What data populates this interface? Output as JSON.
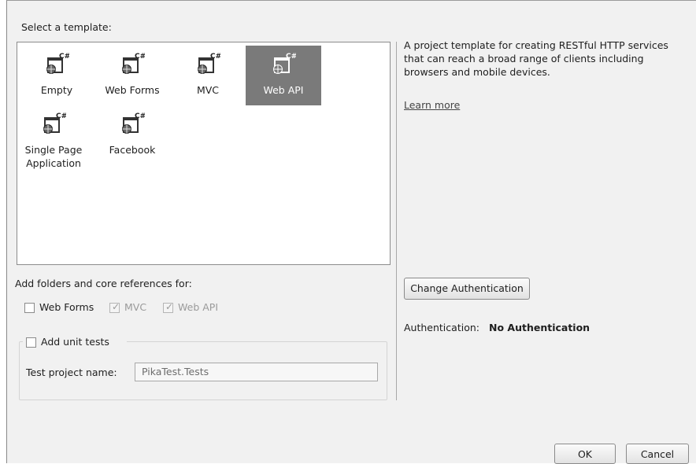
{
  "header": {
    "select_template_label": "Select a template:"
  },
  "templates": [
    {
      "name": "Empty",
      "selected": false,
      "icon": "csharp-web-project-icon"
    },
    {
      "name": "Web Forms",
      "selected": false,
      "icon": "csharp-web-project-icon"
    },
    {
      "name": "MVC",
      "selected": false,
      "icon": "csharp-web-project-icon"
    },
    {
      "name": "Web API",
      "selected": true,
      "icon": "csharp-web-project-icon"
    },
    {
      "name": "Single Page\nApplication",
      "selected": false,
      "icon": "csharp-web-project-icon"
    },
    {
      "name": "Facebook",
      "selected": false,
      "icon": "csharp-web-project-icon"
    }
  ],
  "description": {
    "text": "A project template for creating RESTful HTTP services that can reach a broad range of clients including browsers and mobile devices.",
    "learn_more": "Learn more"
  },
  "folders": {
    "label": "Add folders and core references for:",
    "options": [
      {
        "label": "Web Forms",
        "checked": false,
        "disabled": false
      },
      {
        "label": "MVC",
        "checked": true,
        "disabled": true
      },
      {
        "label": "Web API",
        "checked": true,
        "disabled": true
      }
    ]
  },
  "unit_tests": {
    "label": "Add unit tests",
    "checked": false,
    "project_name_label": "Test project name:",
    "project_name_value": "PikaTest.Tests"
  },
  "auth": {
    "change_button": "Change Authentication",
    "label": "Authentication:",
    "value": "No Authentication"
  },
  "buttons": {
    "ok": "OK",
    "cancel": "Cancel"
  },
  "colors": {
    "selected_tile": "#7a7a7a",
    "dialog_bg": "#f1f1f1"
  }
}
